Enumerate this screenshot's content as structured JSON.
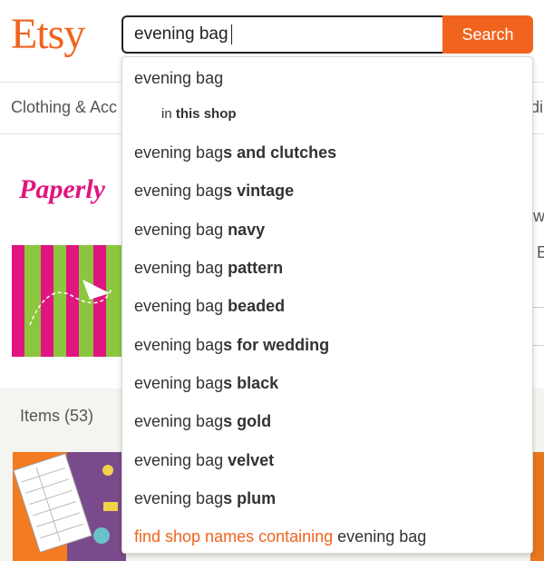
{
  "header": {
    "logo": "Etsy",
    "search_value": "evening bag",
    "search_button": "Search"
  },
  "catnav": {
    "first_item": "Clothing & Acc",
    "right_partial": "di"
  },
  "banner": {
    "shop_name_art": "Paperly",
    "edge_text_1": "w",
    "edge_text_2": "E"
  },
  "items": {
    "label": "Items (53)"
  },
  "dropdown": {
    "first": "evening bag",
    "in_shop_prefix": "in",
    "in_shop_bold": "this shop",
    "suggestions": [
      {
        "base": "evening bag",
        "bold": "s and clutches"
      },
      {
        "base": "evening bag",
        "bold": "s vintage"
      },
      {
        "base": "evening bag ",
        "bold": "navy"
      },
      {
        "base": "evening bag ",
        "bold": "pattern"
      },
      {
        "base": "evening bag ",
        "bold": "beaded"
      },
      {
        "base": "evening bag",
        "bold": "s for wedding"
      },
      {
        "base": "evening bag",
        "bold": "s black"
      },
      {
        "base": "evening bag",
        "bold": "s gold"
      },
      {
        "base": "evening bag ",
        "bold": "velvet"
      },
      {
        "base": "evening bag",
        "bold": "s plum"
      }
    ],
    "find_prefix": "find shop names containing",
    "find_term": "evening bag"
  },
  "colors": {
    "brand": "#F1641E"
  }
}
